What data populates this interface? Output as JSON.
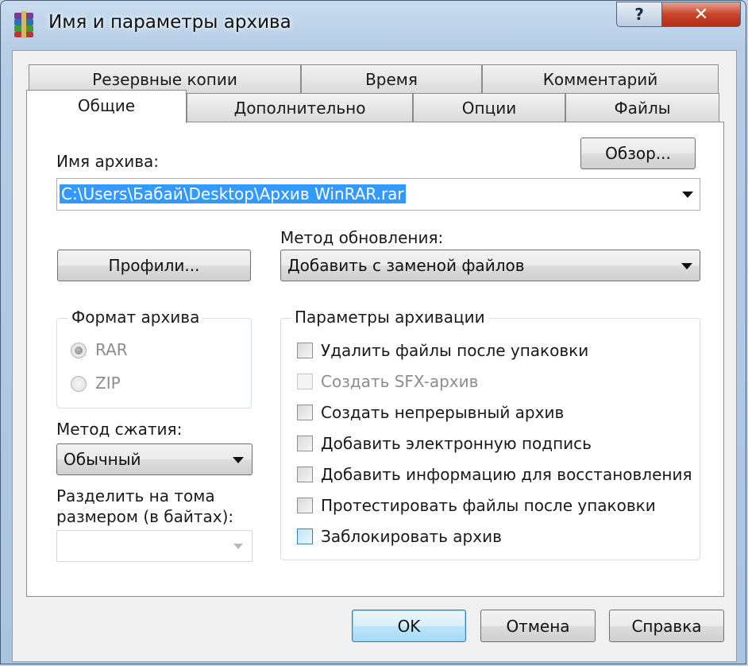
{
  "window": {
    "title": "Имя и параметры архива",
    "help_label": "?",
    "close_label": "✕"
  },
  "tabs_back": [
    {
      "label": "Резервные копии"
    },
    {
      "label": "Время"
    },
    {
      "label": "Комментарий"
    }
  ],
  "tabs_front": [
    {
      "label": "Общие",
      "active": true
    },
    {
      "label": "Дополнительно"
    },
    {
      "label": "Опции"
    },
    {
      "label": "Файлы"
    }
  ],
  "archive_name": {
    "label": "Имя архива:",
    "value": "C:\\Users\\Бабай\\Desktop\\Архив WinRAR.rar",
    "browse_label": "Обзор..."
  },
  "update_method": {
    "label": "Метод обновления:",
    "value": "Добавить с заменой файлов"
  },
  "profiles_label": "Профили...",
  "format": {
    "title": "Формат архива",
    "options": [
      {
        "label": "RAR",
        "checked": true
      },
      {
        "label": "ZIP",
        "checked": false
      }
    ]
  },
  "compression": {
    "label": "Метод сжатия:",
    "value": "Обычный"
  },
  "split": {
    "label_line1": "Разделить на тома",
    "label_line2": "размером (в байтах):",
    "value": ""
  },
  "options": {
    "title": "Параметры архивации",
    "items": [
      {
        "label": "Удалить файлы после упаковки",
        "checked": false,
        "enabled": true
      },
      {
        "label": "Создать SFX-архив",
        "checked": false,
        "enabled": false
      },
      {
        "label": "Создать непрерывный архив",
        "checked": false,
        "enabled": true
      },
      {
        "label": "Добавить электронную подпись",
        "checked": false,
        "enabled": true
      },
      {
        "label": "Добавить информацию для восстановления",
        "checked": false,
        "enabled": true
      },
      {
        "label": "Протестировать файлы после упаковки",
        "checked": false,
        "enabled": true
      },
      {
        "label": "Заблокировать архив",
        "checked": false,
        "enabled": true
      }
    ]
  },
  "buttons": {
    "ok": "OK",
    "cancel": "Отмена",
    "help": "Справка"
  }
}
